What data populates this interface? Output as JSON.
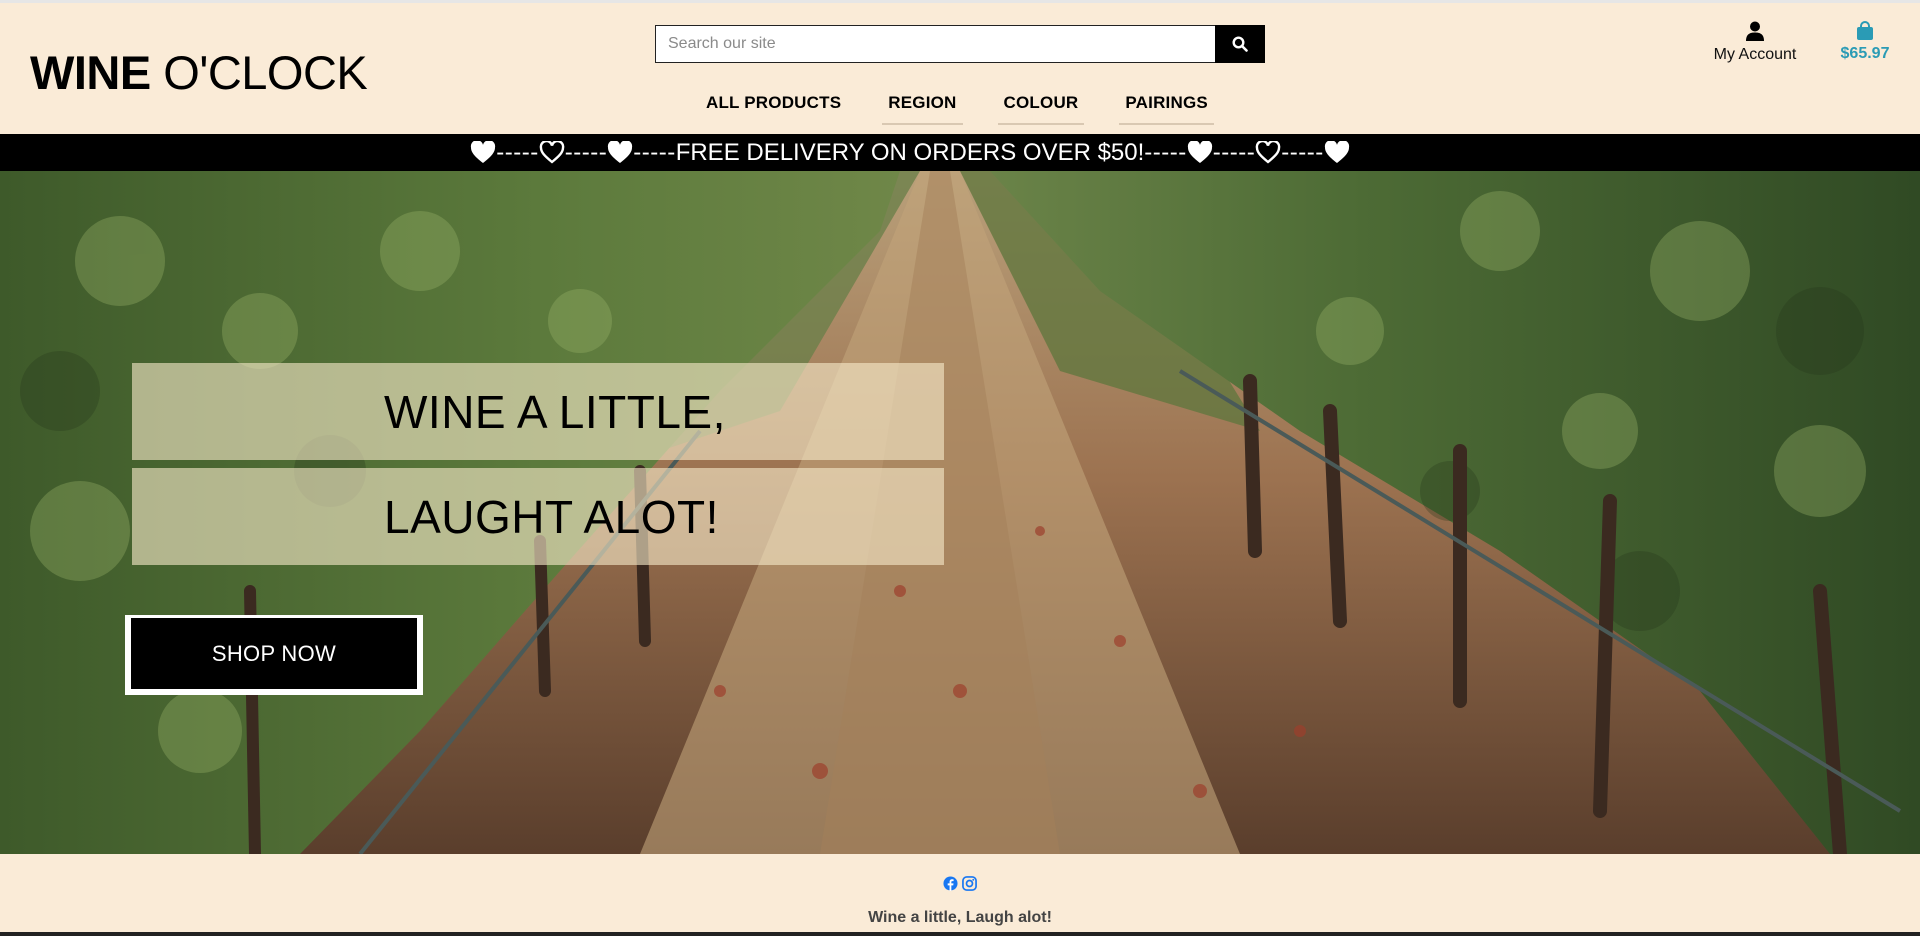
{
  "header": {
    "logo_bold": "WINE",
    "logo_light": "O'CLOCK",
    "search": {
      "placeholder": "Search our site",
      "value": ""
    },
    "nav": [
      {
        "label": "ALL PRODUCTS"
      },
      {
        "label": "REGION"
      },
      {
        "label": "COLOUR"
      },
      {
        "label": "PAIRINGS"
      }
    ],
    "account_label": "My Account",
    "bag_total": "$65.97"
  },
  "banner": {
    "text": "FREE DELIVERY ON ORDERS OVER $50!",
    "separator": "-----"
  },
  "hero": {
    "line1": "WINE A LITTLE,",
    "line2": "LAUGHT ALOT!",
    "cta": "SHOP NOW"
  },
  "footer": {
    "motto": "Wine a little, Laugh alot!",
    "icons": [
      "facebook-icon",
      "instagram-icon"
    ]
  },
  "colors": {
    "page_bg": "#faebd7",
    "banner_bg": "#000000",
    "accent": "#2a9bb5"
  }
}
